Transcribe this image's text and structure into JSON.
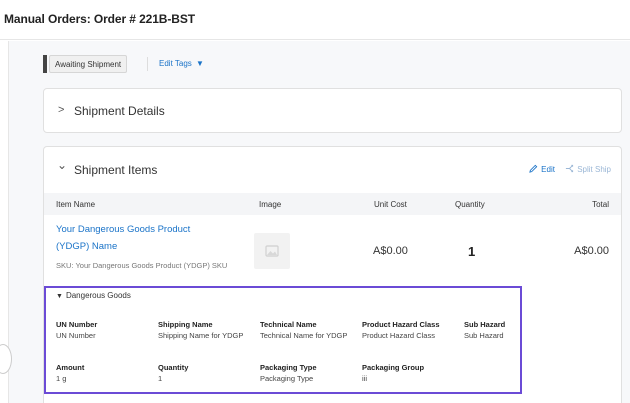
{
  "header": {
    "title": "Manual Orders:  Order # 221B-BST"
  },
  "status": {
    "badge": "Awaiting Shipment",
    "edit_tags": "Edit Tags",
    "caret": "▼"
  },
  "shipment_details": {
    "chevron": ">",
    "title": "Shipment Details"
  },
  "shipment_items": {
    "chevron": "⌄",
    "title": "Shipment Items",
    "edit_label": "Edit",
    "split_label": "Split Ship",
    "columns": {
      "item_name": "Item Name",
      "image": "Image",
      "unit_cost": "Unit Cost",
      "quantity": "Quantity",
      "total": "Total"
    },
    "item": {
      "name": "Your Dangerous Goods Product (YDGP) Name",
      "sku": "SKU: Your Dangerous Goods Product (YDGP) SKU",
      "unit_cost": "A$0.00",
      "quantity": "1",
      "total": "A$0.00"
    }
  },
  "dangerous_goods": {
    "toggle_label": "Dangerous Goods",
    "tri": "▼",
    "row1": [
      {
        "label": "UN Number",
        "value": "UN Number"
      },
      {
        "label": "Shipping Name",
        "value": "Shipping Name for YDGP"
      },
      {
        "label": "Technical Name",
        "value": "Technical Name for YDGP"
      },
      {
        "label": "Product Hazard Class",
        "value": "Product Hazard Class"
      },
      {
        "label": "Sub Hazard",
        "value": "Sub Hazard"
      }
    ],
    "row2": [
      {
        "label": "Amount",
        "value": "1 g"
      },
      {
        "label": "Quantity",
        "value": "1"
      },
      {
        "label": "Packaging Type",
        "value": "Packaging Type"
      },
      {
        "label": "Packaging Group",
        "value": "iii"
      }
    ]
  },
  "colors": {
    "link": "#1a73c8",
    "highlight_border": "#6b4bd6",
    "status_bar": "#444444"
  },
  "icons": [
    "pencil-icon",
    "split-icon",
    "image-placeholder-icon",
    "chevron-right-icon",
    "chevron-down-icon",
    "caret-down-icon"
  ]
}
